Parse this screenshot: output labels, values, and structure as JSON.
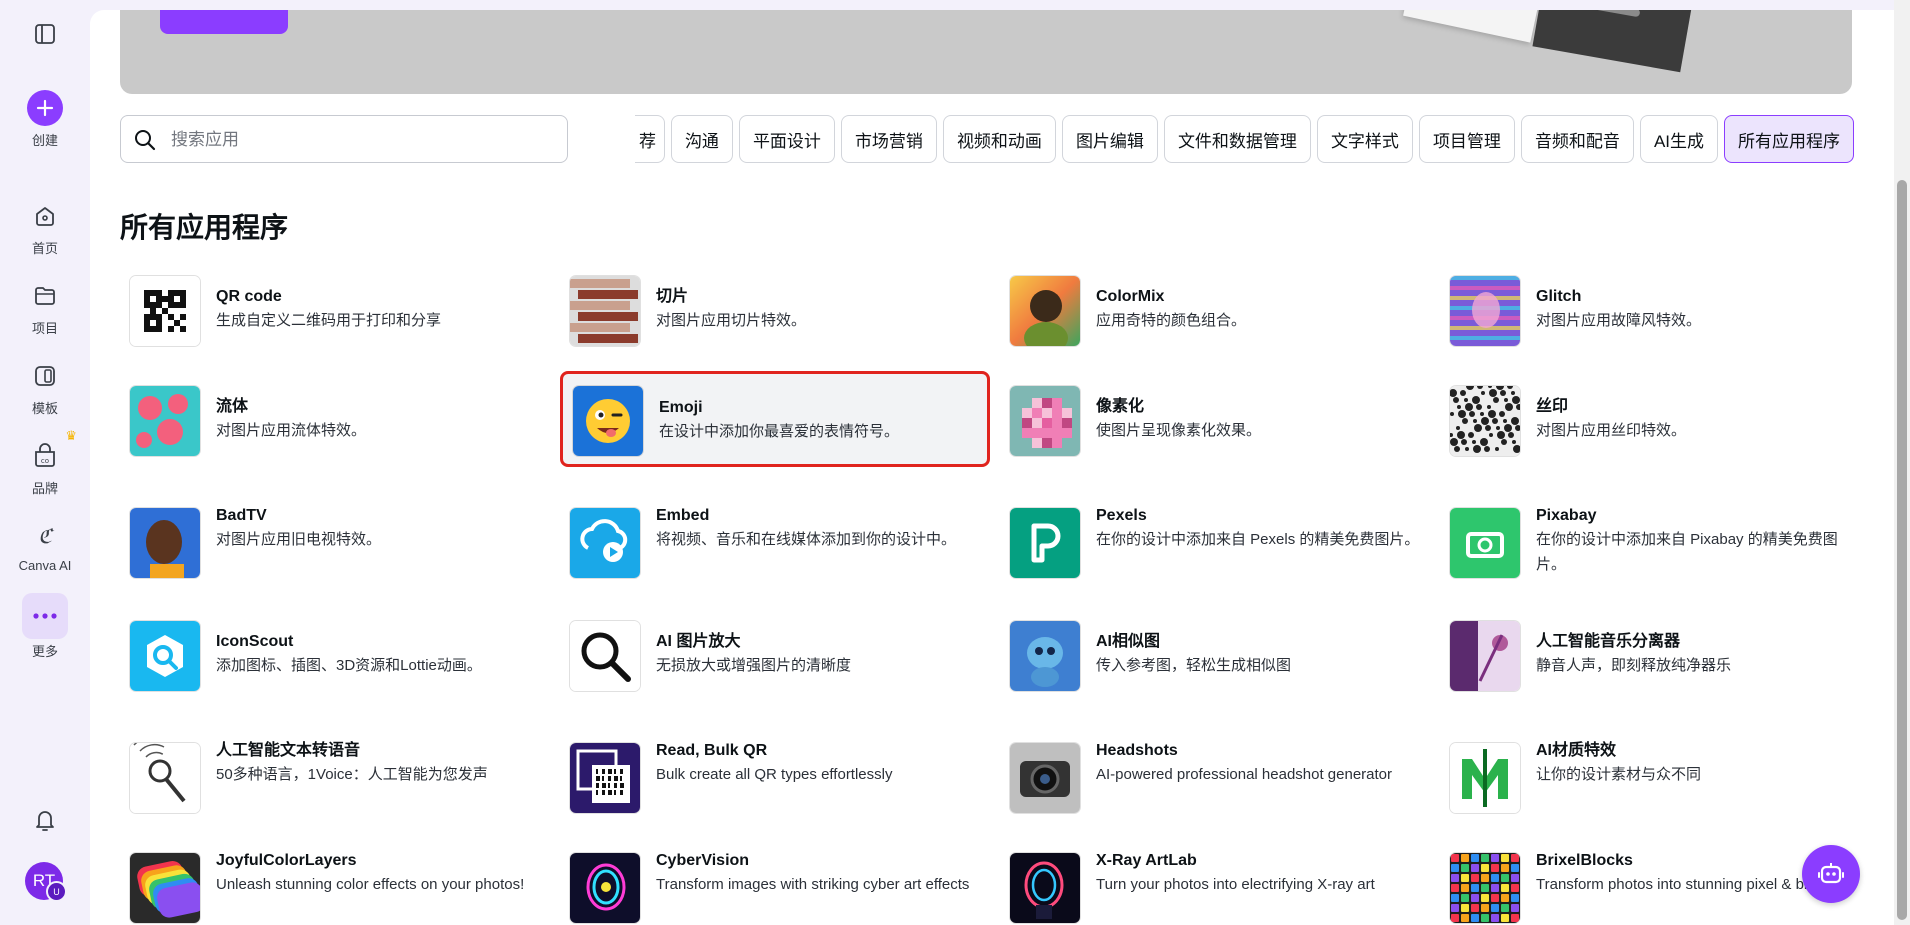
{
  "nav": {
    "create": "创建",
    "home": "首页",
    "projects": "项目",
    "templates": "模板",
    "brand": "品牌",
    "canva_ai": "Canva AI",
    "more": "更多",
    "avatar_initials": "RT",
    "avatar_badge": "U"
  },
  "search": {
    "placeholder": "搜索应用"
  },
  "chips": [
    "荐",
    "沟通",
    "平面设计",
    "市场营销",
    "视频和动画",
    "图片编辑",
    "文件和数据管理",
    "文字样式",
    "项目管理",
    "音频和配音",
    "AI生成",
    "所有应用程序"
  ],
  "active_chip": "所有应用程序",
  "section_title": "所有应用程序",
  "apps": [
    {
      "name": "QR code",
      "desc": "生成自定义二维码用于打印和分享",
      "icon": "qr-code-icon"
    },
    {
      "name": "切片",
      "desc": "对图片应用切片特效。",
      "icon": "slice-icon"
    },
    {
      "name": "ColorMix",
      "desc": "应用奇特的颜色组合。",
      "icon": "colormix-icon"
    },
    {
      "name": "Glitch",
      "desc": "对图片应用故障风特效。",
      "icon": "glitch-icon"
    },
    {
      "name": "流体",
      "desc": "对图片应用流体特效。",
      "icon": "liquify-icon"
    },
    {
      "name": "Emoji",
      "desc": "在设计中添加你最喜爱的表情符号。",
      "icon": "emoji-icon"
    },
    {
      "name": "像素化",
      "desc": "使图片呈现像素化效果。",
      "icon": "pixelate-icon"
    },
    {
      "name": "丝印",
      "desc": "对图片应用丝印特效。",
      "icon": "screen-print-icon"
    },
    {
      "name": "BadTV",
      "desc": "对图片应用旧电视特效。",
      "icon": "badtv-icon"
    },
    {
      "name": "Embed",
      "desc": "将视频、音乐和在线媒体添加到你的设计中。",
      "icon": "embed-icon"
    },
    {
      "name": "Pexels",
      "desc": "在你的设计中添加来自 Pexels 的精美免费图片。",
      "icon": "pexels-icon"
    },
    {
      "name": "Pixabay",
      "desc": "在你的设计中添加来自 Pixabay 的精美免费图片。",
      "icon": "pixabay-icon"
    },
    {
      "name": "IconScout",
      "desc": "添加图标、插图、3D资源和Lottie动画。",
      "icon": "iconscout-icon"
    },
    {
      "name": "AI 图片放大",
      "desc": "无损放大或增强图片的清晰度",
      "icon": "magnifier-icon"
    },
    {
      "name": "AI相似图",
      "desc": "传入参考图，轻松生成相似图",
      "icon": "ai-similar-icon"
    },
    {
      "name": "人工智能音乐分离器",
      "desc": "静音人声，即刻释放纯净器乐",
      "icon": "music-separator-icon"
    },
    {
      "name": "人工智能文本转语音",
      "desc": "50多种语言，1Voice：人工智能为您发声",
      "icon": "microphone-icon"
    },
    {
      "name": "Read, Bulk QR",
      "desc": "Bulk create all QR types effortlessly",
      "icon": "bulk-qr-icon"
    },
    {
      "name": "Headshots",
      "desc": "AI-powered professional headshot generator",
      "icon": "camera-icon"
    },
    {
      "name": "AI材质特效",
      "desc": "让你的设计素材与众不同",
      "icon": "ai-texture-icon"
    },
    {
      "name": "JoyfulColorLayers",
      "desc": "Unleash stunning color effects on your photos!",
      "icon": "color-layers-icon"
    },
    {
      "name": "CyberVision",
      "desc": "Transform images with striking cyber art effects",
      "icon": "cybervision-icon"
    },
    {
      "name": "X-Ray ArtLab",
      "desc": "Turn your photos into electrifying X-ray art",
      "icon": "xray-icon"
    },
    {
      "name": "BrixelBlocks",
      "desc": "Transform photos into stunning pixel & block art",
      "icon": "brixel-icon"
    }
  ],
  "selected_app": "Emoji",
  "colors": {
    "brand": "#8b3dff",
    "selection_border": "#e0241e",
    "active_chip_bg": "#ece4fd"
  }
}
